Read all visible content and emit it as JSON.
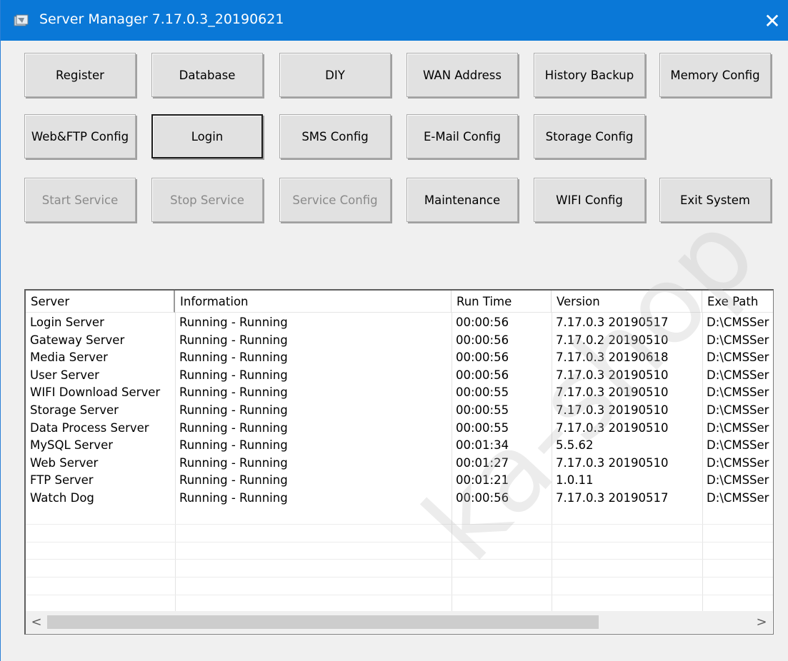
{
  "window": {
    "title": "Server Manager 7.17.0.3_20190621",
    "close_glyph": "✕",
    "icon": "app-icon",
    "accent": "#0a78d7"
  },
  "buttons": {
    "row1": [
      "Register",
      "Database",
      "DIY",
      "WAN Address",
      "History Backup",
      "Memory Config"
    ],
    "row2": [
      "Web&FTP Config",
      "Login",
      "SMS Config",
      "E-Mail Config",
      "Storage Config"
    ],
    "row3": [
      "Start Service",
      "Stop Service",
      "Service Config",
      "Maintenance",
      "WIFI Config",
      "Exit System"
    ]
  },
  "table": {
    "columns": [
      "Server",
      "Information",
      "Run Time",
      "Version",
      "Exe Path"
    ],
    "rows": [
      [
        "Login Server",
        "Running - Running",
        "00:00:56",
        "7.17.0.3 20190517",
        "D:\\CMSSer"
      ],
      [
        "Gateway Server",
        "Running - Running",
        "00:00:56",
        "7.17.0.2 20190510",
        "D:\\CMSSer"
      ],
      [
        "Media Server",
        "Running - Running",
        "00:00:56",
        "7.17.0.3 20190618",
        "D:\\CMSSer"
      ],
      [
        "User Server",
        "Running - Running",
        "00:00:56",
        "7.17.0.3 20190510",
        "D:\\CMSSer"
      ],
      [
        "WIFI Download Server",
        "Running - Running",
        "00:00:55",
        "7.17.0.3 20190510",
        "D:\\CMSSer"
      ],
      [
        "Storage Server",
        "Running - Running",
        "00:00:55",
        "7.17.0.3 20190510",
        "D:\\CMSSer"
      ],
      [
        "Data Process Server",
        "Running - Running",
        "00:00:55",
        "7.17.0.3 20190510",
        "D:\\CMSSer"
      ],
      [
        "MySQL Server",
        "Running - Running",
        "00:01:34",
        "5.5.62",
        "D:\\CMSSer"
      ],
      [
        "Web Server",
        "Running - Running",
        "00:01:27",
        "7.17.0.3 20190510",
        "D:\\CMSSer"
      ],
      [
        "FTP Server",
        "Running - Running",
        "00:01:21",
        "1.0.11",
        "D:\\CMSSer"
      ],
      [
        "Watch Dog",
        "Running - Running",
        "00:00:56",
        "7.17.0.3 20190517",
        "D:\\CMSSer"
      ]
    ]
  },
  "scrollbar": {
    "left_arrow": "<",
    "right_arrow": ">"
  },
  "watermark": "ka-shop"
}
